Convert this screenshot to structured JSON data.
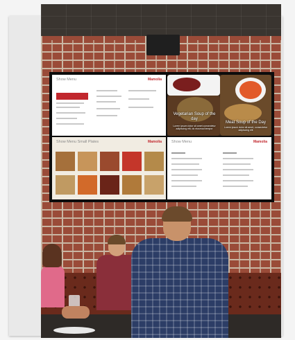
{
  "photo": {
    "menu_board": {
      "top_left": {
        "title": "Show Menu",
        "brand": "Mamolia"
      },
      "top_right": {
        "left_caption": "Vegetarian Soup of the day",
        "left_subcaption": "Lorem ipsum dolor sit amet consectetur adipiscing elit, do eiusmod tempor",
        "right_caption": "Meat Soup of the Day",
        "right_subcaption": "Lorem ipsum dolor sit amet, consectetur adipiscing elit"
      },
      "bottom_left": {
        "title": "Show Menu Small Plates",
        "brand": "Mamolia"
      },
      "bottom_right": {
        "title": "Show Menu",
        "brand": "Mamolia"
      }
    }
  }
}
